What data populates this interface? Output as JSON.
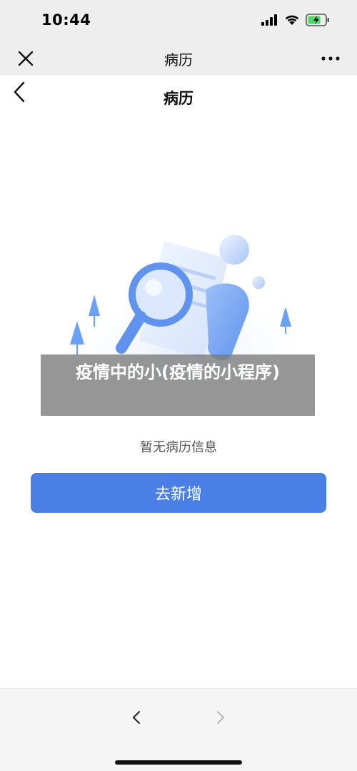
{
  "status_bar": {
    "time": "10:44",
    "icons": [
      "signal-icon",
      "wifi-icon",
      "battery-charging-icon"
    ]
  },
  "wx_bar": {
    "title": "病历",
    "icons": [
      "close-icon",
      "more-icon"
    ]
  },
  "page": {
    "title": "病历",
    "back_icon": "chevron-left-icon"
  },
  "overlay": {
    "text": "疫情中的小(疫情的小程序)"
  },
  "empty_state": {
    "message": "暂无病历信息"
  },
  "actions": {
    "add_label": "去新增"
  },
  "bottom_nav": {
    "icons": [
      "back-arrow-icon",
      "forward-arrow-icon"
    ]
  },
  "colors": {
    "accent": "#4a7fe6",
    "bar_background": "#eeeeee",
    "illustration_blue": "#6aa0f5"
  }
}
